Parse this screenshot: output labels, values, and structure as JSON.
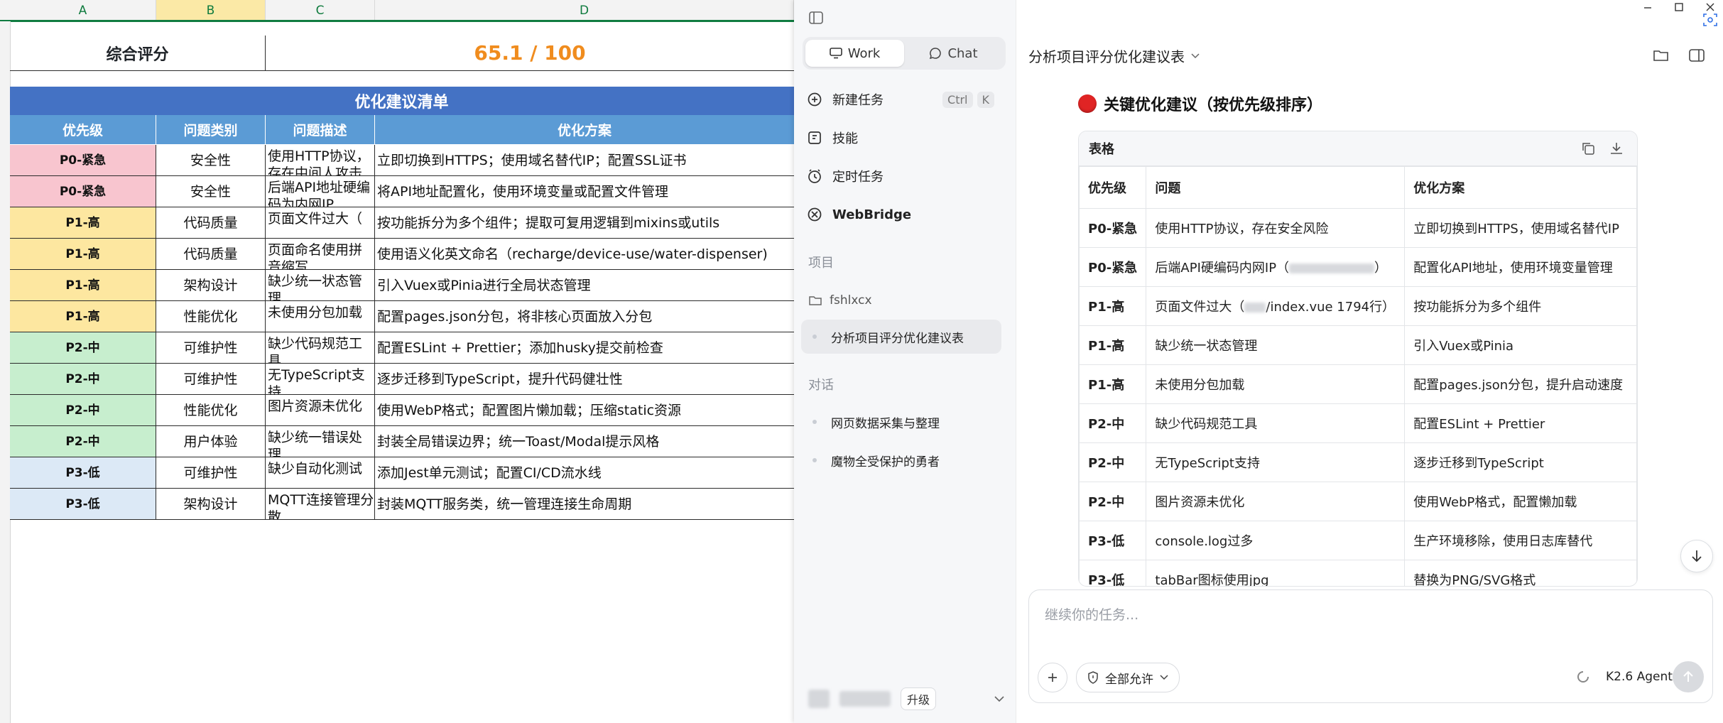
{
  "spreadsheet": {
    "columns": [
      "A",
      "B",
      "C",
      "D"
    ],
    "score_label": "综合评分",
    "score_value": "65.1 / 100",
    "list_title": "优化建议清单",
    "headers": [
      "优先级",
      "问题类别",
      "问题描述",
      "优化方案"
    ],
    "rows": [
      {
        "priority": "P0-紧急",
        "category": "安全性",
        "issue": "使用HTTP协议，存在中间人攻击风险",
        "solution": "立即切换到HTTPS；使用域名替代IP；配置SSL证书"
      },
      {
        "priority": "P0-紧急",
        "category": "安全性",
        "issue": "后端API地址硬编码为内网IP",
        "solution": "将API地址配置化，使用环境变量或配置文件管理"
      },
      {
        "priority": "P1-高",
        "category": "代码质量",
        "issue": "页面文件过大（",
        "solution": "按功能拆分为多个组件；提取可复用逻辑到mixins或utils"
      },
      {
        "priority": "P1-高",
        "category": "代码质量",
        "issue": "页面命名使用拼音缩写",
        "solution": "使用语义化英文命名（recharge/device-use/water-dispenser)"
      },
      {
        "priority": "P1-高",
        "category": "架构设计",
        "issue": "缺少统一状态管理",
        "solution": "引入Vuex或Pinia进行全局状态管理"
      },
      {
        "priority": "P1-高",
        "category": "性能优化",
        "issue": "未使用分包加载",
        "solution": "配置pages.json分包，将非核心页面放入分包"
      },
      {
        "priority": "P2-中",
        "category": "可维护性",
        "issue": "缺少代码规范工具",
        "solution": "配置ESLint + Prettier；添加husky提交前检查"
      },
      {
        "priority": "P2-中",
        "category": "可维护性",
        "issue": "无TypeScript支持",
        "solution": "逐步迁移到TypeScript，提升代码健壮性"
      },
      {
        "priority": "P2-中",
        "category": "性能优化",
        "issue": "图片资源未优化",
        "solution": "使用WebP格式；配置图片懒加载；压缩static资源"
      },
      {
        "priority": "P2-中",
        "category": "用户体验",
        "issue": "缺少统一错误处理",
        "solution": "封装全局错误边界；统一Toast/Modal提示风格"
      },
      {
        "priority": "P3-低",
        "category": "可维护性",
        "issue": "缺少自动化测试",
        "solution": "添加Jest单元测试；配置CI/CD流水线"
      },
      {
        "priority": "P3-低",
        "category": "架构设计",
        "issue": "MQTT连接管理分散",
        "solution": "封装MQTT服务类，统一管理连接生命周期"
      }
    ]
  },
  "sidebar": {
    "tabs": {
      "work": "Work",
      "chat": "Chat"
    },
    "nav": [
      {
        "label": "新建任务",
        "icon": "plus-circle-icon"
      },
      {
        "label": "技能",
        "icon": "skills-icon"
      },
      {
        "label": "定时任务",
        "icon": "clock-icon"
      },
      {
        "label": "WebBridge",
        "icon": "webbridge-icon"
      }
    ],
    "shortcut": [
      "Ctrl",
      "K"
    ],
    "projects_label": "项目",
    "project_name": "fshlxcx",
    "project_task": "分析项目评分优化建议表",
    "chats_label": "对话",
    "chats": [
      "网页数据采集与整理",
      "魔物全受保护的勇者"
    ],
    "upgrade": "升级"
  },
  "main": {
    "title": "分析项目评分优化建议表",
    "heading": "关键优化建议（按优先级排序）",
    "table_label": "表格",
    "table_headers": [
      "优先级",
      "问题",
      "优化方案"
    ],
    "table_rows": [
      {
        "priority": "P0-紧急",
        "issue": "使用HTTP协议，存在安全风险",
        "solution": "立即切换到HTTPS，使用域名替代IP"
      },
      {
        "priority": "P0-紧急",
        "issue_prefix": "后端API硬编码内网IP（",
        "issue_suffix": "）",
        "solution": "配置化API地址，使用环境变量管理"
      },
      {
        "priority": "P1-高",
        "issue_prefix": "页面文件过大（",
        "issue_suffix": "/index.vue 1794行）",
        "solution": "按功能拆分为多个组件"
      },
      {
        "priority": "P1-高",
        "issue": "缺少统一状态管理",
        "solution": "引入Vuex或Pinia"
      },
      {
        "priority": "P1-高",
        "issue": "未使用分包加载",
        "solution": "配置pages.json分包，提升启动速度"
      },
      {
        "priority": "P2-中",
        "issue": "缺少代码规范工具",
        "solution": "配置ESLint + Prettier"
      },
      {
        "priority": "P2-中",
        "issue": "无TypeScript支持",
        "solution": "逐步迁移到TypeScript"
      },
      {
        "priority": "P2-中",
        "issue": "图片资源未优化",
        "solution": "使用WebP格式，配置懒加载"
      },
      {
        "priority": "P3-低",
        "issue": "console.log过多",
        "solution": "生产环境移除，使用日志库替代"
      },
      {
        "priority": "P3-低",
        "issue": "tabBar图标使用jpg",
        "solution": "替换为PNG/SVG格式"
      }
    ],
    "composer_placeholder": "继续你的任务...",
    "permission": "全部允许",
    "agent": "K2.6 Agent"
  },
  "colors": {
    "P0": "#f8c5cf",
    "P1": "#fde7a0",
    "P2": "#c7eece",
    "P3": "#dce9f6",
    "sheet_title": "#4472c4",
    "sheet_header": "#5b9bd5",
    "score": "#f08c1e"
  }
}
